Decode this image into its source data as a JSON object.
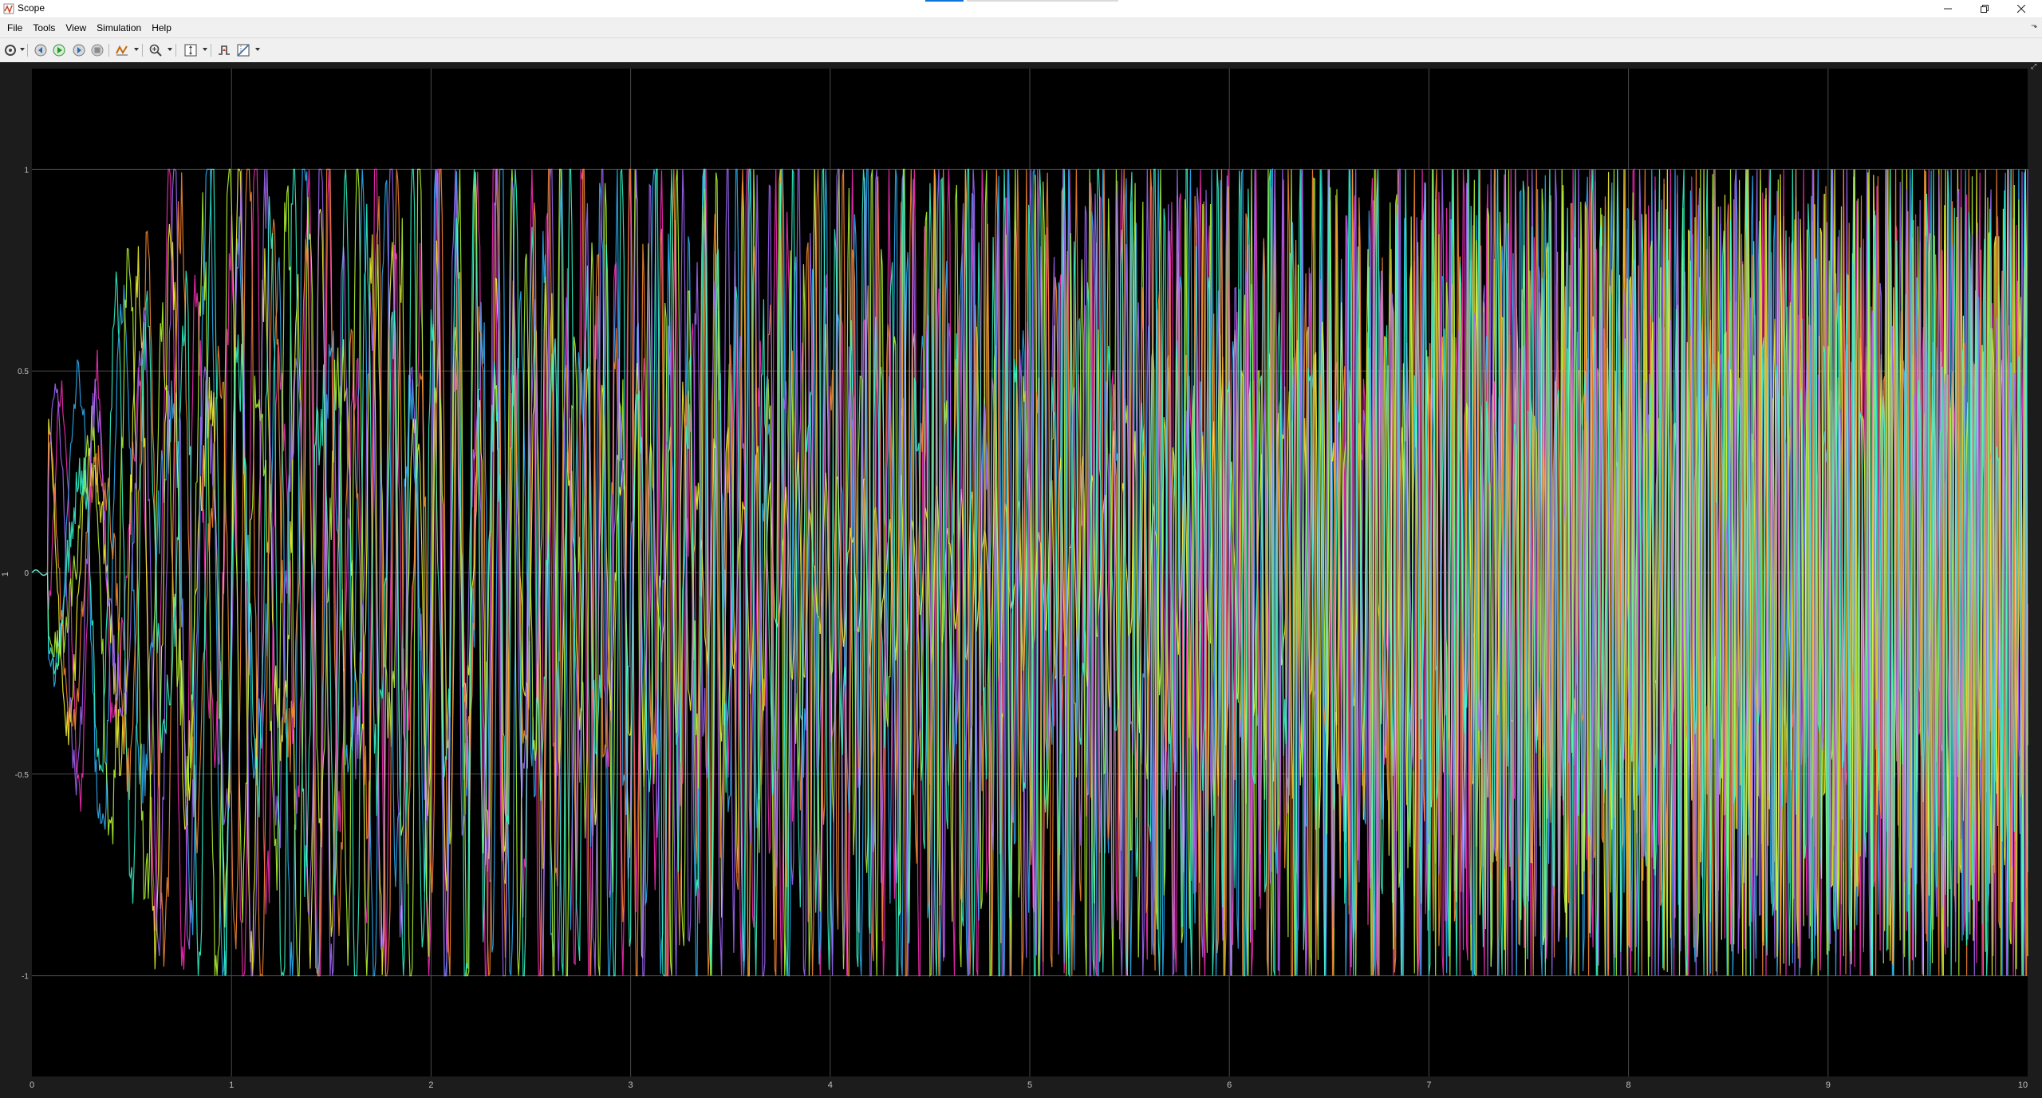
{
  "window": {
    "title": "Scope"
  },
  "menu": {
    "items": [
      "File",
      "Tools",
      "View",
      "Simulation",
      "Help"
    ]
  },
  "toolbar": {
    "icons": [
      "settings-gear-icon",
      "step-back-icon",
      "run-icon",
      "step-forward-icon",
      "stop-icon",
      "highlight-signal-icon",
      "zoom-icon",
      "scale-axes-icon",
      "triggers-icon",
      "measurements-icon"
    ]
  },
  "colors": {
    "plot_background": "#000000",
    "figure_background": "#1c1c1c",
    "grid": "#4a4a4a",
    "tick_label": "#c0c0c0",
    "series": [
      "#ff2fbd",
      "#2fb5ff",
      "#ffff33",
      "#b8ff33",
      "#ff8c33",
      "#a56bff",
      "#33ffd0"
    ]
  },
  "chart_data": {
    "type": "line",
    "title": "",
    "xlabel": "",
    "ylabel": "",
    "xlim": [
      0,
      10
    ],
    "ylim": [
      -1.25,
      1.25
    ],
    "xticks": [
      "0",
      "1",
      "2",
      "3",
      "4",
      "5",
      "6",
      "7",
      "8",
      "9",
      "10"
    ],
    "yticks": [
      "1",
      "0.5",
      "0",
      "-0.5",
      "-1"
    ],
    "grid": true,
    "legend": "none",
    "series": [
      {
        "color": "#ff2fbd",
        "kind": "oscillating signal amplitude 1, frequency increasing"
      },
      {
        "color": "#2fb5ff",
        "kind": "oscillating signal amplitude 1, frequency increasing"
      },
      {
        "color": "#ffff33",
        "kind": "oscillating signal, low amplitude around 0 in middle"
      },
      {
        "color": "#b8ff33",
        "kind": "oscillating signal amplitude 1"
      },
      {
        "color": "#ff8c33",
        "kind": "oscillating signal amplitude 1"
      },
      {
        "color": "#a56bff",
        "kind": "oscillating signal amplitude 1"
      },
      {
        "color": "#33ffd0",
        "kind": "oscillating signal amplitude 1"
      }
    ]
  }
}
